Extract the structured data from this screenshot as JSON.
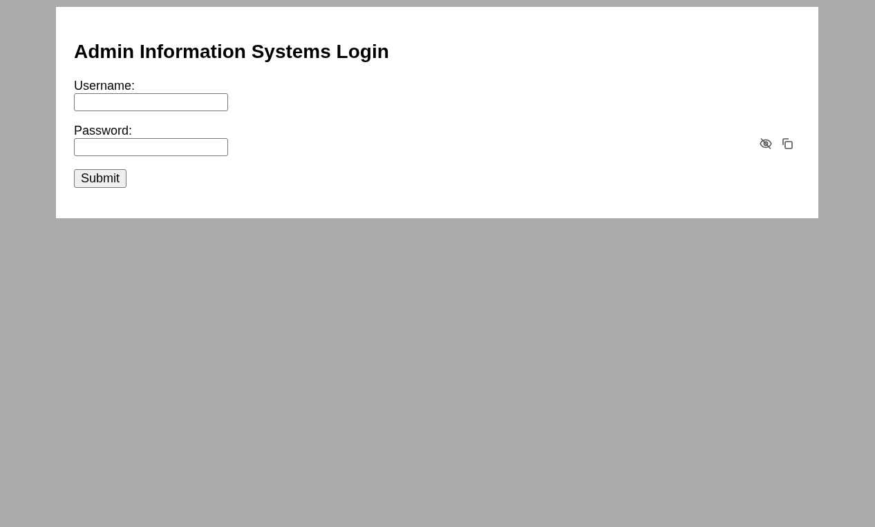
{
  "title": "Admin Information Systems Login",
  "fields": [
    {
      "label": "Username:",
      "kind": "text"
    },
    {
      "label": "Password:",
      "kind": "password"
    }
  ],
  "submit": {
    "label": "Submit"
  }
}
